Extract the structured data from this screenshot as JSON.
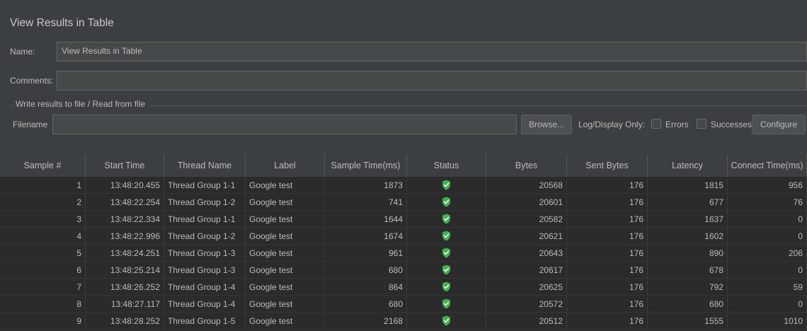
{
  "panel": {
    "title": "View Results in Table",
    "name_label": "Name:",
    "name_value": "View Results in Table",
    "comments_label": "Comments:",
    "comments_value": "",
    "file_group_title": "Write results to file / Read from file",
    "filename_label": "Filename",
    "filename_value": "",
    "browse_label": "Browse...",
    "log_display_label": "Log/Display Only:",
    "errors_label": "Errors",
    "errors_checked": false,
    "successes_label": "Successes",
    "successes_checked": false,
    "configure_label": "Configure"
  },
  "table": {
    "columns": [
      "Sample #",
      "Start Time",
      "Thread Name",
      "Label",
      "Sample Time(ms)",
      "Status",
      "Bytes",
      "Sent Bytes",
      "Latency",
      "Connect Time(ms)"
    ],
    "status_icon": "success-shield-icon",
    "status_color": "#3fb34f",
    "rows": [
      [
        "1",
        "13:48:20.455",
        "Thread Group 1-1",
        "Google test",
        "1873",
        "success",
        "20568",
        "176",
        "1815",
        "956"
      ],
      [
        "2",
        "13:48:22.254",
        "Thread Group 1-2",
        "Google test",
        "741",
        "success",
        "20601",
        "176",
        "677",
        "76"
      ],
      [
        "3",
        "13:48:22.334",
        "Thread Group 1-1",
        "Google test",
        "1644",
        "success",
        "20582",
        "176",
        "1637",
        "0"
      ],
      [
        "4",
        "13:48:22.996",
        "Thread Group 1-2",
        "Google test",
        "1674",
        "success",
        "20621",
        "176",
        "1602",
        "0"
      ],
      [
        "5",
        "13:48:24.251",
        "Thread Group 1-3",
        "Google test",
        "961",
        "success",
        "20643",
        "176",
        "890",
        "206"
      ],
      [
        "6",
        "13:48:25.214",
        "Thread Group 1-3",
        "Google test",
        "680",
        "success",
        "20617",
        "176",
        "678",
        "0"
      ],
      [
        "7",
        "13:48:26.252",
        "Thread Group 1-4",
        "Google test",
        "864",
        "success",
        "20625",
        "176",
        "792",
        "59"
      ],
      [
        "8",
        "13:48:27.117",
        "Thread Group 1-4",
        "Google test",
        "680",
        "success",
        "20572",
        "176",
        "680",
        "0"
      ],
      [
        "9",
        "13:48:28.252",
        "Thread Group 1-5",
        "Google test",
        "2168",
        "success",
        "20512",
        "176",
        "1555",
        "1010"
      ]
    ]
  }
}
